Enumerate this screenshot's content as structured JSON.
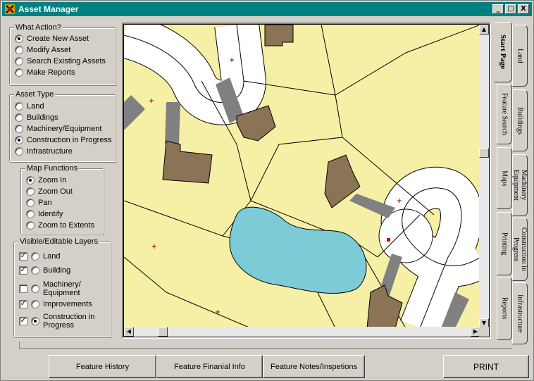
{
  "window": {
    "title": "Asset Manager",
    "minimize": "_",
    "maximize": "□",
    "close": "X"
  },
  "what_action": {
    "legend": "What Action?",
    "options": [
      {
        "label": "Create New Asset",
        "selected": true
      },
      {
        "label": "Modify Asset",
        "selected": false
      },
      {
        "label": "Search Existing Assets",
        "selected": false
      },
      {
        "label": "Make Reports",
        "selected": false
      }
    ]
  },
  "asset_type": {
    "legend": "Asset Type",
    "options": [
      {
        "label": "Land",
        "selected": false
      },
      {
        "label": "Buildings",
        "selected": false
      },
      {
        "label": "Machinery/Equipment",
        "selected": false
      },
      {
        "label": "Construction in Progress",
        "selected": true
      },
      {
        "label": "Infrastructure",
        "selected": false
      }
    ]
  },
  "map_functions": {
    "legend": "Map Functions",
    "options": [
      {
        "label": "Zoom In",
        "selected": true
      },
      {
        "label": "Zoom Out",
        "selected": false
      },
      {
        "label": "Pan",
        "selected": false
      },
      {
        "label": "Identify",
        "selected": false
      },
      {
        "label": "Zoom to Extents",
        "selected": false
      }
    ]
  },
  "layers": {
    "legend": "Visible/Editable Layers",
    "items": [
      {
        "label": "Land",
        "visible": true,
        "editable": false
      },
      {
        "label": "Building",
        "visible": true,
        "editable": false
      },
      {
        "label": "Machinery/\nEquipment",
        "visible": false,
        "editable": false
      },
      {
        "label": "Improvements",
        "visible": true,
        "editable": false
      },
      {
        "label": "Construction in\nProgress",
        "visible": true,
        "editable": true
      }
    ]
  },
  "tabs": {
    "active": "Start Page",
    "col_inner": [
      "Start Page",
      "Feature Search",
      "Maps",
      "Printing",
      "Reports"
    ],
    "col_outer": [
      "Land",
      "Buildings",
      "Machinery\nEquipment",
      "Construction in\nProgress",
      "Infrastructure"
    ]
  },
  "buttons": {
    "history": "Feature History",
    "financial": "Feature Finanial Info",
    "notes": "Feature Notes/Inspetions",
    "print": "PRINT"
  },
  "colors": {
    "titlebar": "#008080",
    "parcel": "#f6f0a6",
    "building": "#8b7355",
    "driveway": "#808080",
    "pond": "#7ecbd8",
    "road": "#ffffff"
  }
}
